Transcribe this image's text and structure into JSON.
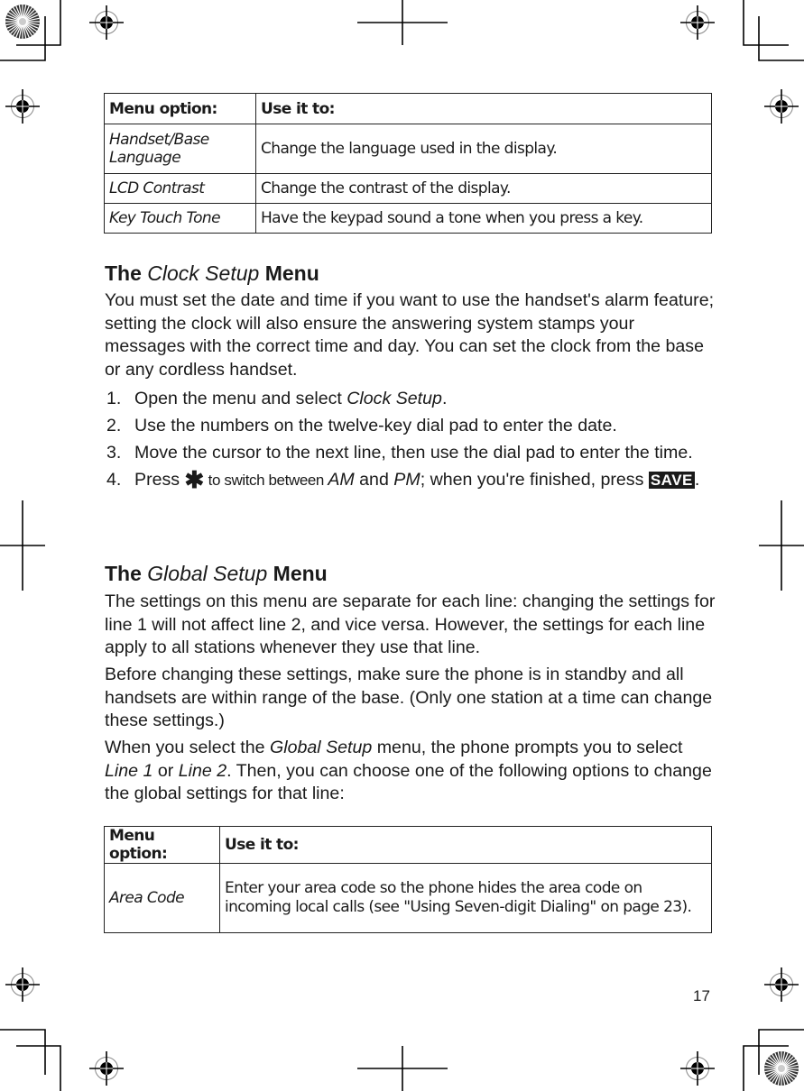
{
  "table1": {
    "headers": [
      "Menu option:",
      "Use it to:"
    ],
    "rows": [
      {
        "option_line1": "Handset/Base",
        "option_line2": "Language",
        "description": "Change the language used in the display."
      },
      {
        "option": "LCD Contrast",
        "description": "Change the contrast of the display."
      },
      {
        "option": "Key Touch Tone",
        "description": "Have the keypad sound a tone when you press a key."
      }
    ]
  },
  "clock_section": {
    "heading_prefix": "The",
    "heading_italic": "Clock Setup",
    "heading_suffix": "Menu",
    "intro": "You must set the date and time if you want to use the handset's alarm feature; setting the clock will also ensure the answering system stamps your messages with the correct time and day. You can set the clock from the base or any cordless handset.",
    "steps": [
      {
        "num": "1.",
        "text_before": "Open the menu and select ",
        "italic": "Clock Setup",
        "text_after": "."
      },
      {
        "num": "2.",
        "text": "Use the numbers on the twelve-key dial pad to enter the date."
      },
      {
        "num": "3.",
        "text": "Move the cursor to the next line, then use the dial pad to enter the time."
      },
      {
        "num": "4.",
        "press": "Press ",
        "star_key": "✱",
        "switch_text": " to switch between ",
        "am": "AM",
        "and": " and ",
        "pm": "PM",
        "finished": "; when you're finished, press ",
        "save_key": "SAVE",
        "end": "."
      }
    ]
  },
  "global_section": {
    "heading_prefix": "The",
    "heading_italic": "Global Setup",
    "heading_suffix": "Menu",
    "para1": "The settings on this menu are separate for each line: changing the settings for line 1 will not affect line 2, and vice versa. However, the settings for each line apply to all stations whenever they use that line.",
    "para2": "Before changing these settings, make sure the phone is in standby and all handsets are within range of the base. (Only one station at a time can change these settings.)",
    "para3_a": "When you select the ",
    "para3_italic1": "Global Setup",
    "para3_b": " menu, the phone prompts you to select ",
    "para3_italic2": "Line 1",
    "para3_c": " or ",
    "para3_italic3": "Line 2",
    "para3_d": ". Then, you can choose one of the following options to change the global settings for that line:"
  },
  "table2": {
    "headers": [
      "Menu option:",
      "Use it to:"
    ],
    "rows": [
      {
        "option": "Area Code",
        "description": "Enter your area code so the phone hides the area code on incoming local calls (see \"Using Seven-digit Dialing\" on page 23)."
      }
    ]
  },
  "page_number": "17"
}
